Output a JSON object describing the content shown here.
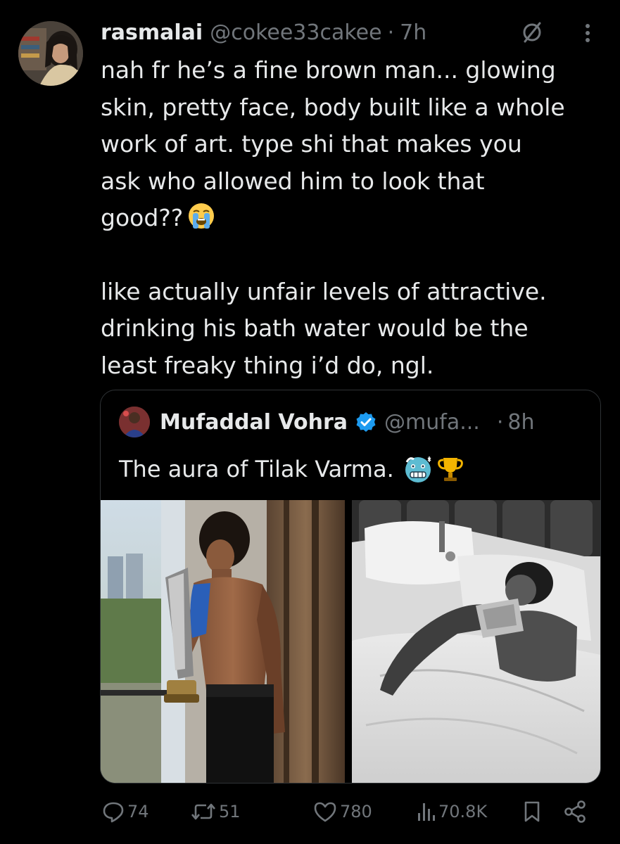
{
  "tweet": {
    "display_name": "rasmalai",
    "handle": "@cokee33cakee",
    "separator": "·",
    "time": "7h",
    "text_lines_1": "nah fr he’s a fine brown man... glowing\nskin, pretty face, body built like a whole\nwork of art. type shi that makes you\nask who allowed him to look that\ngood??",
    "text_lines_2": "like actually unfair levels of attractive.\ndrinking his bath water would be the\nleast freaky thing i’d do, ngl.",
    "emoji_after_text": "loudly-crying-face-emoji"
  },
  "quote": {
    "display_name": "Mufaddal Vohra",
    "verified": true,
    "handle": "@mufa...",
    "separator": "·",
    "time": "8h",
    "text": "The aura of Tilak Varma.",
    "emojis": [
      "cold-face-emoji",
      "trophy-emoji"
    ],
    "media": [
      "photo-shirtless-with-trophy-by-window",
      "photo-black-and-white-sleeping-with-trophy"
    ]
  },
  "actions": {
    "replies": "74",
    "retweets": "51",
    "likes": "780",
    "views": "70.8K",
    "icons": [
      "reply-icon",
      "retweet-icon",
      "like-icon",
      "views-icon",
      "bookmark-icon",
      "share-icon"
    ]
  },
  "colors": {
    "background": "#000000",
    "text_primary": "#e7e9ea",
    "text_secondary": "#71767b",
    "border": "#2f3336",
    "verified_blue": "#1d9bf0"
  }
}
